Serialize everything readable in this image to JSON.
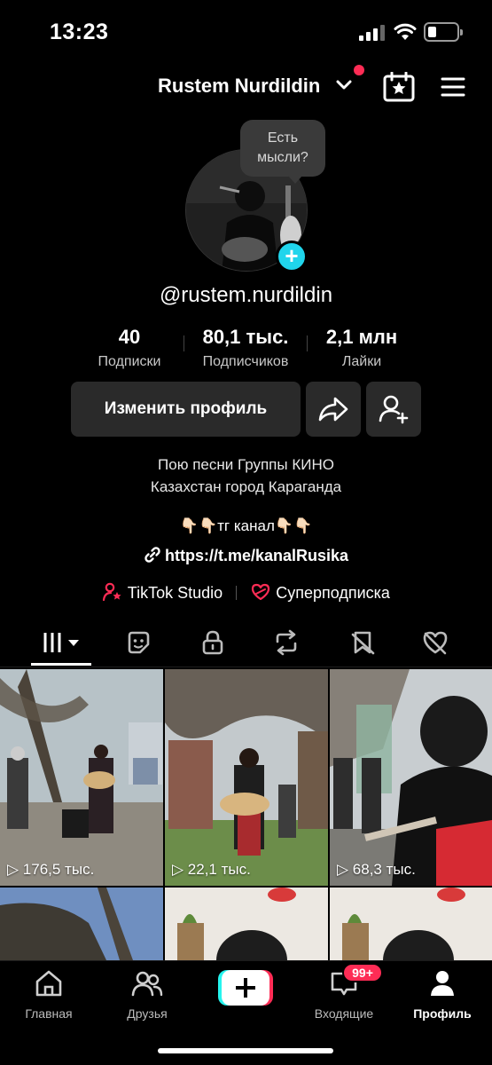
{
  "status": {
    "time": "13:23"
  },
  "header": {
    "username": "Rustem Nurdildin"
  },
  "profile": {
    "bubble": "Есть мысли?",
    "handle": "@rustem.nurdildin",
    "stats": [
      {
        "value": "40",
        "label": "Подписки"
      },
      {
        "value": "80,1 тыс.",
        "label": "Подписчиков"
      },
      {
        "value": "2,1 млн",
        "label": "Лайки"
      }
    ],
    "edit_button": "Изменить профиль",
    "bio_line1": "Пою песни Группы КИНО",
    "bio_line2": "Казахстан город Караганда",
    "tg_line": "👇🏻👇🏻тг канал👇🏻👇🏻",
    "link": "https://t.me/kanalRusika",
    "studio": "TikTok Studio",
    "superfollow": "Суперподписка"
  },
  "videos": [
    {
      "views": "176,5 тыс."
    },
    {
      "views": "22,1 тыс."
    },
    {
      "views": "68,3 тыс."
    }
  ],
  "nav": {
    "home": "Главная",
    "friends": "Друзья",
    "inbox": "Входящие",
    "inbox_badge": "99+",
    "profile": "Профиль"
  },
  "colors": {
    "accent": "#fe2c55",
    "cyan": "#20d5ec",
    "background": "#000000"
  }
}
